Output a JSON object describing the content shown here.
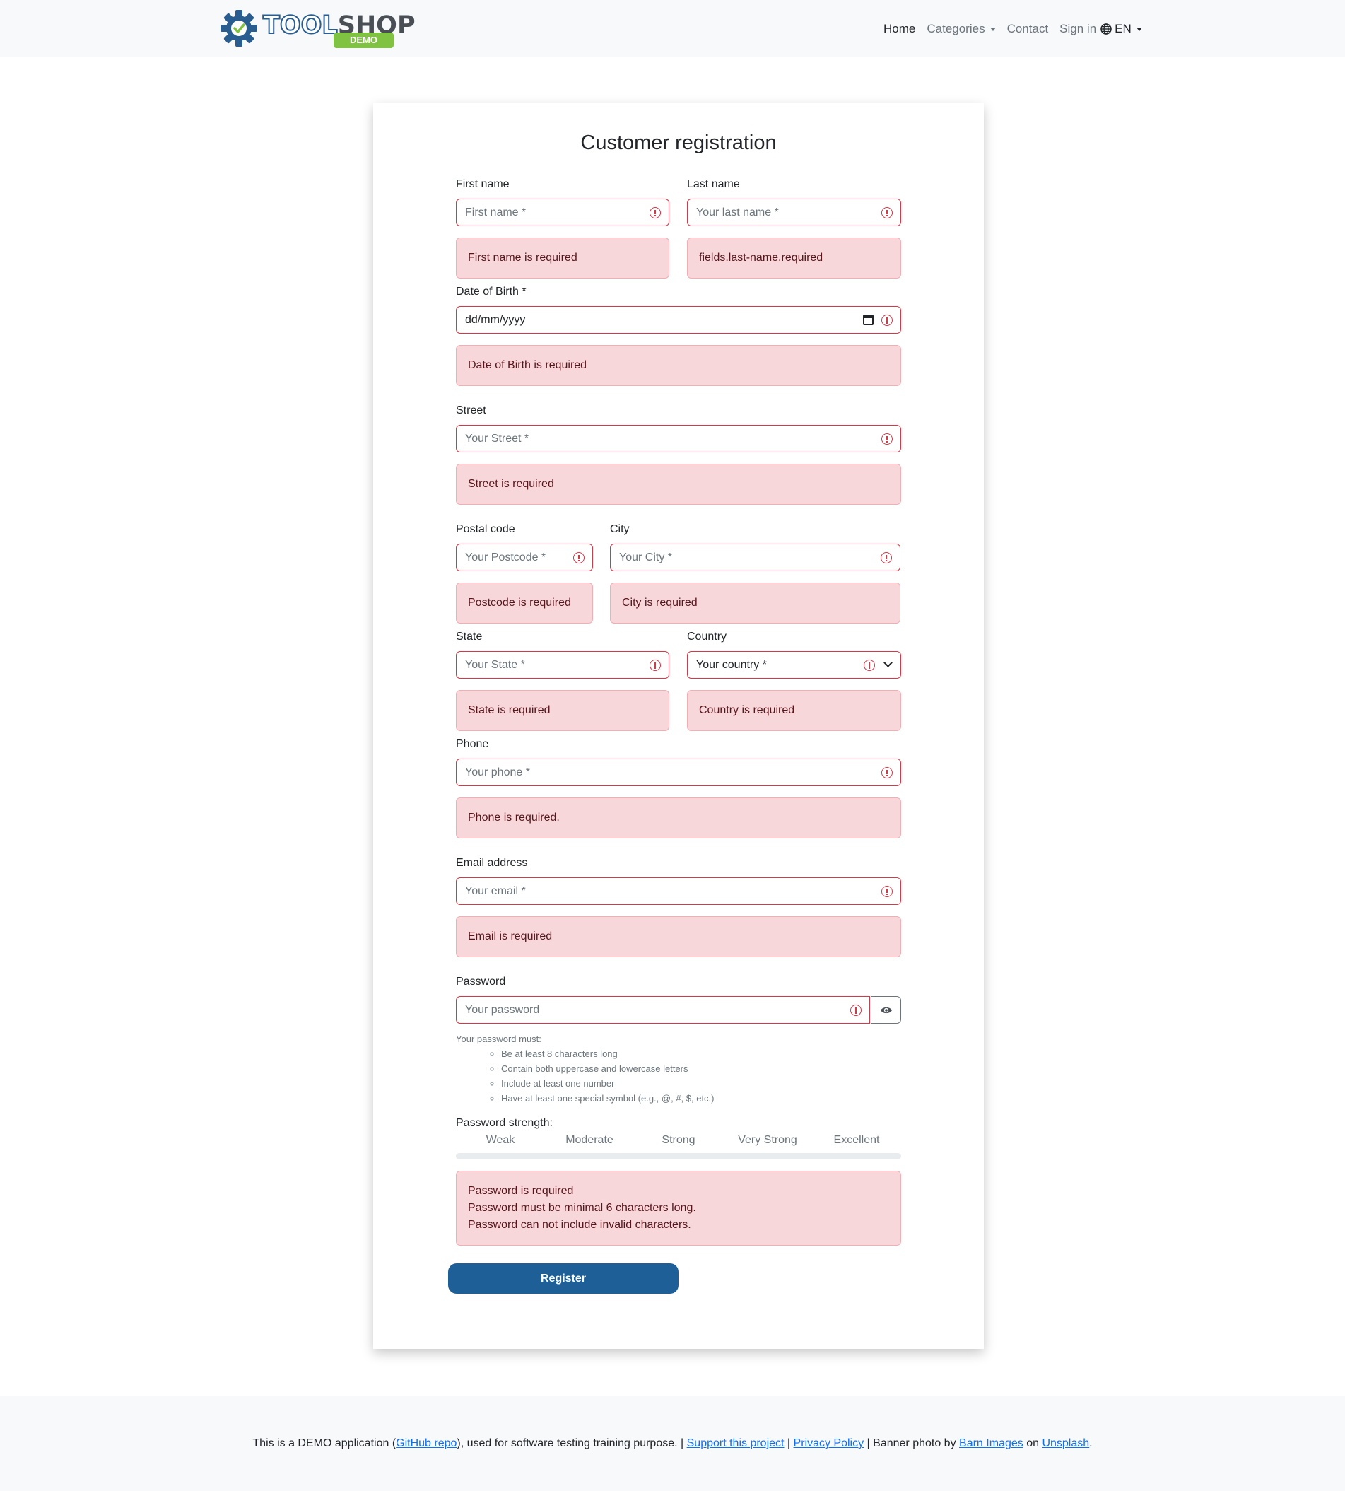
{
  "brand": {
    "part1": "TOOL",
    "part2": "SHOP",
    "badge": "DEMO",
    "icon": "gear-check-icon"
  },
  "nav": {
    "home": "Home",
    "categories": "Categories",
    "contact": "Contact",
    "sign_in": "Sign in",
    "language": "EN",
    "language_icon": "globe-icon"
  },
  "form": {
    "title": "Customer registration",
    "first_name": {
      "label": "First name",
      "placeholder": "First name *",
      "error": "First name is required"
    },
    "last_name": {
      "label": "Last name",
      "placeholder": "Your last name *",
      "error": "fields.last-name.required"
    },
    "dob": {
      "label": "Date of Birth *",
      "placeholder": "dd/mm/yyyy",
      "error": "Date of Birth is required"
    },
    "street": {
      "label": "Street",
      "placeholder": "Your Street *",
      "error": "Street is required"
    },
    "postal_code": {
      "label": "Postal code",
      "placeholder": "Your Postcode *",
      "error": "Postcode is required"
    },
    "city": {
      "label": "City",
      "placeholder": "Your City *",
      "error": "City is required"
    },
    "state": {
      "label": "State",
      "placeholder": "Your State *",
      "error": "State is required"
    },
    "country": {
      "label": "Country",
      "selected": "Your country *",
      "error": "Country is required"
    },
    "phone": {
      "label": "Phone",
      "placeholder": "Your phone *",
      "error": "Phone is required."
    },
    "email": {
      "label": "Email address",
      "placeholder": "Your email *",
      "error": "Email is required"
    },
    "password": {
      "label": "Password",
      "placeholder": "Your password",
      "hint_title": "Your password must:",
      "rules": [
        "Be at least 8 characters long",
        "Contain both uppercase and lowercase letters",
        "Include at least one number",
        "Have at least one special symbol (e.g., @, #, $, etc.)"
      ],
      "strength_label": "Password strength:",
      "strength_levels": [
        "Weak",
        "Moderate",
        "Strong",
        "Very Strong",
        "Excellent"
      ],
      "strength_value": 0,
      "errors": [
        "Password is required",
        "Password must be minimal 6 characters long.",
        "Password can not include invalid characters."
      ]
    },
    "submit": "Register"
  },
  "footer": {
    "t1": "This is a DEMO application (",
    "github": "GitHub repo",
    "t2": "), used for software testing training purpose. | ",
    "support": "Support this project",
    "t3": " | ",
    "privacy": "Privacy Policy",
    "t4": " | Banner photo by ",
    "barn": "Barn Images",
    "t5": " on ",
    "unsplash": "Unsplash",
    "t6": "."
  },
  "colors": {
    "error": "#dc3545",
    "error_bg": "#f8d7da",
    "primary": "#1d5f96",
    "brand_green": "#80c342"
  }
}
